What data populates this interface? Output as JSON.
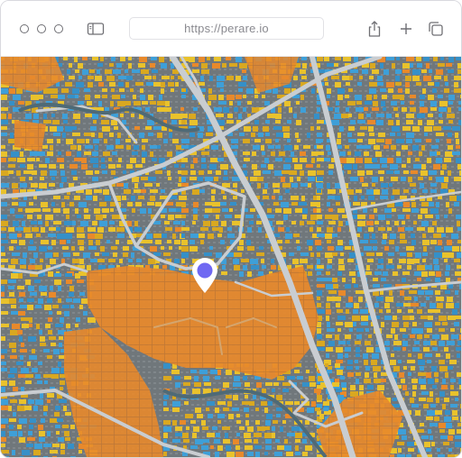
{
  "browser": {
    "url": "https://perare.io",
    "window_controls": [
      "close",
      "minimize",
      "zoom"
    ],
    "left_icons": [
      "sidebar-icon"
    ],
    "right_icons": [
      "share-icon",
      "new-tab-icon",
      "tabs-overview-icon"
    ]
  },
  "map": {
    "type": "satellite-parcel-overlay",
    "parcel_colors": {
      "orange": "#e8892b",
      "yellow": "#e9c22c",
      "blue": "#3e9fd8",
      "road": "#c9cdd1",
      "background": "#6d7478"
    },
    "location_marker": {
      "fill": "#6f68f2",
      "border": "#ffffff"
    }
  }
}
